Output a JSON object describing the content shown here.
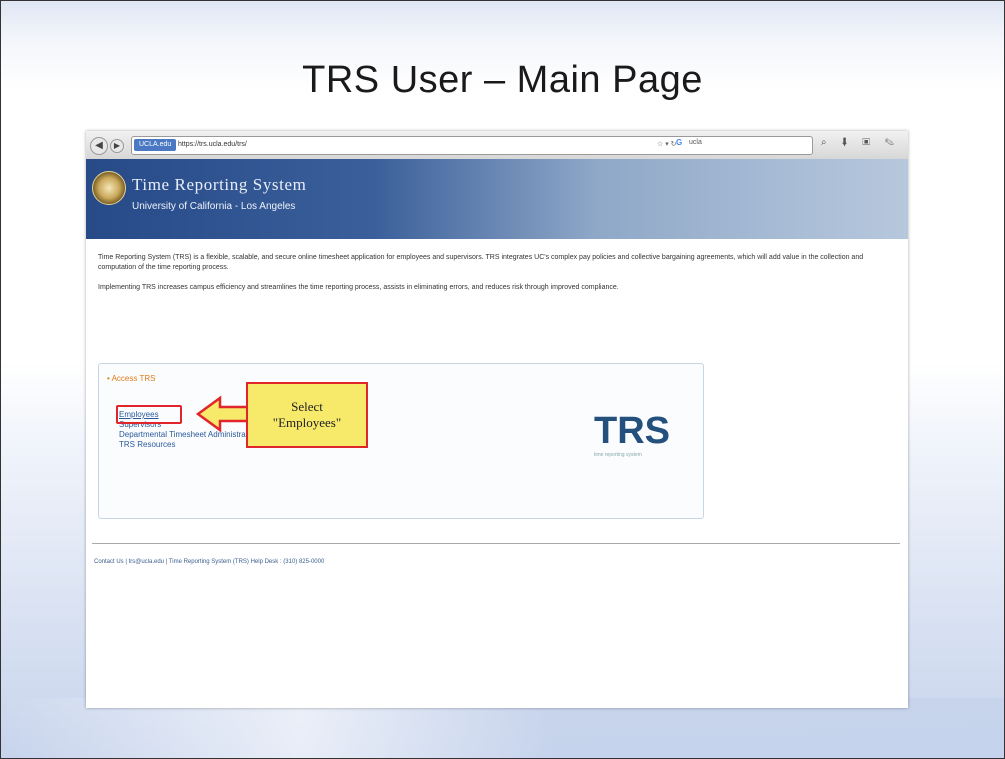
{
  "slide": {
    "title": "TRS User – Main Page"
  },
  "browser": {
    "url_identity": "UCLA.edu",
    "url": "https://trs.ucla.edu/trs/",
    "search_text": "ucla"
  },
  "header": {
    "system_name": "Time Reporting System",
    "university": "University of California - Los Angeles"
  },
  "intro": {
    "p1": "Time Reporting System (TRS) is a flexible, scalable, and secure online timesheet application for employees and supervisors. TRS integrates UC's complex pay policies and collective bargaining agreements, which will add value in the collection and computation of the time reporting process.",
    "p2": "Implementing TRS increases campus efficiency and streamlines the time reporting process, assists in eliminating errors, and reduces risk through improved compliance."
  },
  "access": {
    "heading": "• Access TRS",
    "links": [
      "Employees",
      "Supervisors",
      "Departmental Timesheet Administrators",
      "TRS Resources"
    ],
    "logo": "TRS",
    "logo_tagline": "time reporting system"
  },
  "callout": {
    "line1": "Select",
    "line2": "\"Employees\""
  },
  "footer": {
    "text": "Contact Us | trs@ucla.edu | Time Reporting System (TRS) Help Desk : (310) 825-0000"
  },
  "colors": {
    "callout_bg": "#f7e96a",
    "callout_border": "#e0262b",
    "banner": "#274a88"
  }
}
